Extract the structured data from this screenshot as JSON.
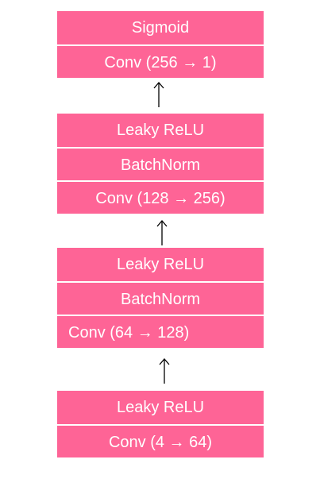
{
  "diagram": {
    "blocks": [
      {
        "layers": [
          {
            "label": "Sigmoid"
          },
          {
            "label": "Conv (256 → 1)"
          }
        ]
      },
      {
        "layers": [
          {
            "label": "Leaky ReLU"
          },
          {
            "label": "BatchNorm"
          },
          {
            "label": "Conv (128 → 256)"
          }
        ]
      },
      {
        "layers": [
          {
            "label": "Leaky ReLU"
          },
          {
            "label": "BatchNorm"
          },
          {
            "label": "Conv (64 → 128)"
          }
        ]
      },
      {
        "layers": [
          {
            "label": "Leaky ReLU"
          },
          {
            "label": "Conv (4 → 64)"
          }
        ]
      }
    ],
    "colors": {
      "block_fill": "#fe6496",
      "block_text": "#ffffff",
      "arrow": "#000000"
    }
  }
}
